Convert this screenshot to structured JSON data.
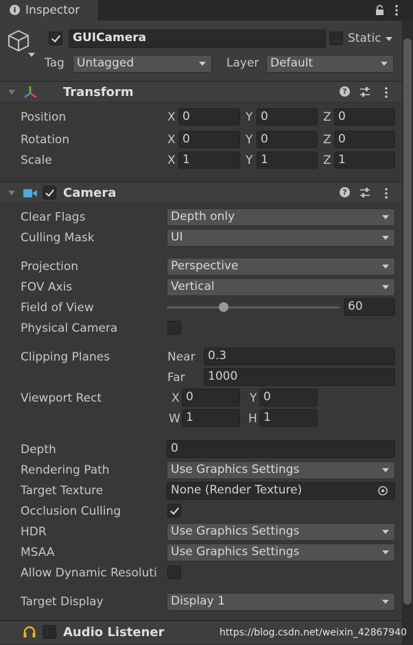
{
  "tab": {
    "title": "Inspector"
  },
  "header": {
    "object_name": "GUICamera",
    "static_label": "Static",
    "tag_label": "Tag",
    "tag_value": "Untagged",
    "layer_label": "Layer",
    "layer_value": "Default"
  },
  "transform": {
    "title": "Transform",
    "position": {
      "label": "Position",
      "x": "0",
      "y": "0",
      "z": "0"
    },
    "rotation": {
      "label": "Rotation",
      "x": "0",
      "y": "0",
      "z": "0"
    },
    "scale": {
      "label": "Scale",
      "x": "1",
      "y": "1",
      "z": "1"
    },
    "axis_x": "X",
    "axis_y": "Y",
    "axis_z": "Z"
  },
  "camera": {
    "title": "Camera",
    "clear_flags": {
      "label": "Clear Flags",
      "value": "Depth only"
    },
    "culling_mask": {
      "label": "Culling Mask",
      "value": "UI"
    },
    "projection": {
      "label": "Projection",
      "value": "Perspective"
    },
    "fov_axis": {
      "label": "FOV Axis",
      "value": "Vertical"
    },
    "field_of_view": {
      "label": "Field of View",
      "value": "60",
      "slider_fraction": 0.33
    },
    "physical_camera": {
      "label": "Physical Camera"
    },
    "clipping_planes": {
      "label": "Clipping Planes",
      "near_label": "Near",
      "near": "0.3",
      "far_label": "Far",
      "far": "1000"
    },
    "viewport_rect": {
      "label": "Viewport Rect",
      "x_label": "X",
      "x": "0",
      "y_label": "Y",
      "y": "0",
      "w_label": "W",
      "w": "1",
      "h_label": "H",
      "h": "1"
    },
    "depth": {
      "label": "Depth",
      "value": "0"
    },
    "rendering_path": {
      "label": "Rendering Path",
      "value": "Use Graphics Settings"
    },
    "target_texture": {
      "label": "Target Texture",
      "value": "None (Render Texture)"
    },
    "occlusion_culling": {
      "label": "Occlusion Culling"
    },
    "hdr": {
      "label": "HDR",
      "value": "Use Graphics Settings"
    },
    "msaa": {
      "label": "MSAA",
      "value": "Use Graphics Settings"
    },
    "allow_dynamic_resolution": {
      "label": "Allow Dynamic Resoluti"
    },
    "target_display": {
      "label": "Target Display",
      "value": "Display 1"
    }
  },
  "audio_listener": {
    "title": "Audio Listener"
  },
  "watermark": "https://blog.csdn.net/weixin_42867940",
  "colors": {
    "background": "#383838",
    "field": "#2a2a2a",
    "dropdown": "#515151",
    "camera_icon": "#4fa8e0",
    "audio_icon": "#e8b820"
  }
}
